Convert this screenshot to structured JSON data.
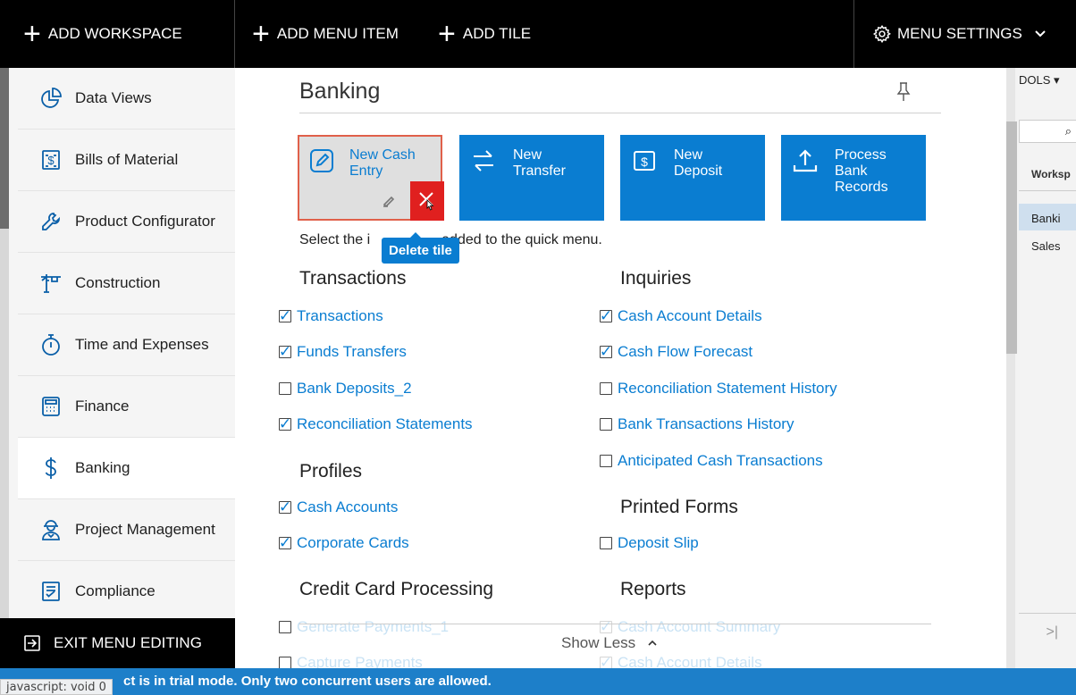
{
  "topbar": {
    "add_workspace": "ADD WORKSPACE",
    "add_menu_item": "ADD MENU ITEM",
    "add_tile": "ADD TILE",
    "menu_settings": "MENU SETTINGS"
  },
  "sidebar": {
    "items": [
      {
        "label": "Data Views",
        "icon": "pie-chart-icon"
      },
      {
        "label": "Bills of Material",
        "icon": "document-dollar-icon"
      },
      {
        "label": "Product Configurator",
        "icon": "wrench-icon"
      },
      {
        "label": "Construction",
        "icon": "crane-icon"
      },
      {
        "label": "Time and Expenses",
        "icon": "stopwatch-icon"
      },
      {
        "label": "Finance",
        "icon": "calculator-icon"
      },
      {
        "label": "Banking",
        "icon": "dollar-icon"
      },
      {
        "label": "Project Management",
        "icon": "worker-icon"
      },
      {
        "label": "Compliance",
        "icon": "checklist-icon"
      }
    ],
    "active": "Banking",
    "exit_label": "EXIT MENU EDITING"
  },
  "main": {
    "title": "Banking",
    "tiles": [
      {
        "label": "New Cash\nEntry",
        "icon": "pencil-square-icon"
      },
      {
        "label": "New\nTransfer",
        "icon": "transfer-arrows-icon"
      },
      {
        "label": "New\nDeposit",
        "icon": "dollar-box-icon"
      },
      {
        "label": "Process\nBank\nRecords",
        "icon": "upload-icon"
      }
    ],
    "tooltip": "Delete tile",
    "hint_prefix": "Select the i",
    "hint_suffix": "added to the quick menu.",
    "show_less": "Show Less"
  },
  "sections": {
    "transactions": {
      "title": "Transactions",
      "items": [
        {
          "label": "Transactions",
          "checked": true
        },
        {
          "label": "Funds Transfers",
          "checked": true
        },
        {
          "label": "Bank Deposits_2",
          "checked": false
        },
        {
          "label": "Reconciliation Statements",
          "checked": true
        }
      ]
    },
    "profiles": {
      "title": "Profiles",
      "items": [
        {
          "label": "Cash Accounts",
          "checked": true
        },
        {
          "label": "Corporate Cards",
          "checked": true
        }
      ]
    },
    "credit_card": {
      "title": "Credit Card Processing",
      "items": [
        {
          "label": "Generate Payments_1",
          "checked": false
        },
        {
          "label": "Capture Payments",
          "checked": false
        }
      ]
    },
    "inquiries": {
      "title": "Inquiries",
      "items": [
        {
          "label": "Cash Account Details",
          "checked": true
        },
        {
          "label": "Cash Flow Forecast",
          "checked": true
        },
        {
          "label": "Reconciliation Statement History",
          "checked": false
        },
        {
          "label": "Bank Transactions History",
          "checked": false
        },
        {
          "label": "Anticipated Cash Transactions",
          "checked": false
        }
      ]
    },
    "printed_forms": {
      "title": "Printed Forms",
      "items": [
        {
          "label": "Deposit Slip",
          "checked": false
        }
      ]
    },
    "reports": {
      "title": "Reports",
      "items": [
        {
          "label": "Cash Account Summary",
          "checked": true
        },
        {
          "label": "Cash Account Details",
          "checked": true
        }
      ]
    }
  },
  "background": {
    "tools": "DOLS",
    "column_header": "Worksp",
    "rows": [
      "Banki",
      "Sales"
    ]
  },
  "status": {
    "message": "ct is in trial mode. Only two concurrent users are allowed.",
    "url": "javascript: void 0"
  },
  "colors": {
    "accent": "#0a7dd1",
    "delete": "#e0201f",
    "topbar": "#000000",
    "statusbar": "#1d7fc9"
  }
}
